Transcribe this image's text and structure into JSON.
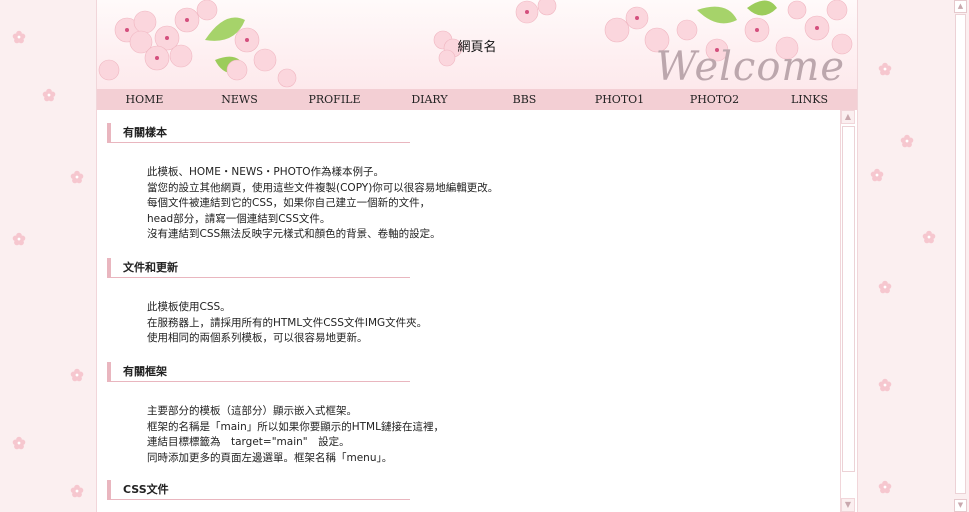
{
  "header": {
    "site_title": "網頁名",
    "welcome_text": "Welcome"
  },
  "nav": {
    "items": [
      "HOME",
      "NEWS",
      "PROFILE",
      "DIARY",
      "BBS",
      "PHOTO1",
      "PHOTO2",
      "LINKS"
    ]
  },
  "sections": [
    {
      "title": "有關樣本",
      "lines": [
        "此模板、HOME・NEWS・PHOTO作為樣本例子。",
        "當您的設立其他網頁，使用這些文件複製(COPY)你可以很容易地編輯更改。",
        "每個文件被連結到它的CSS，如果你自己建立一個新的文件，",
        "head部分，請寫一個連結到CSS文件。",
        "沒有連結到CSS無法反映字元樣式和顏色的背景、卷軸的設定。"
      ]
    },
    {
      "title": "文件和更新",
      "lines": [
        "此模板使用CSS。",
        "在服務器上，請採用所有的HTML文件CSS文件IMG文件夾。",
        "使用相同的兩個系列模板，可以很容易地更新。"
      ]
    },
    {
      "title": "有關框架",
      "lines": [
        "主要部分的模板（這部分）顯示嵌入式框架。",
        "框架的名稱是「main」所以如果你要顯示的HTML鏈接在這裡，",
        "連結目標標籤為　target=\"main\"　設定。",
        "同時添加更多的頁面左邊選單。框架名稱「menu」。"
      ]
    },
    {
      "title": "CSS文件",
      "lines": []
    }
  ],
  "icons": {
    "scroll_up": "scroll-up-arrow",
    "scroll_down": "scroll-down-arrow"
  },
  "colors": {
    "nav_bg": "#f3cfd4",
    "accent": "#e9b6bf",
    "page_bg": "#fbeff0"
  }
}
